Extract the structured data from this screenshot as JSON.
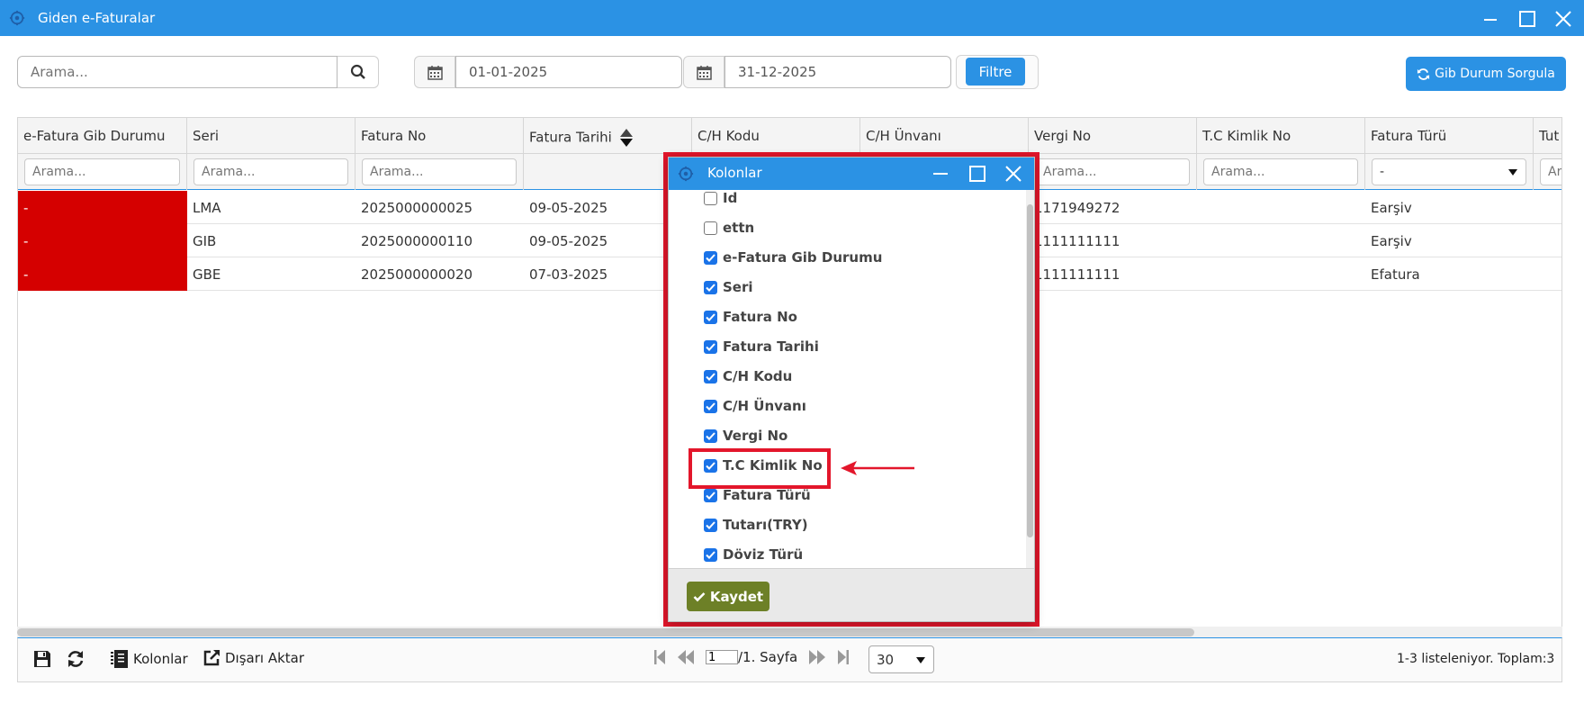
{
  "window": {
    "title": "Giden e-Faturalar",
    "icons": [
      "gear-icon",
      "minimize-icon",
      "maximize-icon",
      "close-icon"
    ]
  },
  "toolbar": {
    "search_placeholder": "Arama...",
    "date_start": "01-01-2025",
    "date_end": "31-12-2025",
    "filter_label": "Filtre",
    "gib_button_label": "Gib Durum Sorgula"
  },
  "grid": {
    "columns": [
      "e-Fatura Gib Durumu",
      "Seri",
      "Fatura No",
      "Fatura Tarihi",
      "C/H Kodu",
      "C/H Ünvanı",
      "Vergi No",
      "T.C Kimlik No",
      "Fatura Türü",
      "Tut"
    ],
    "filter_placeholder": "Arama...",
    "filter_placeholder_clipped": "Ar",
    "fatura_turu_filter_value": "-",
    "rows": [
      {
        "status": "-",
        "seri": "LMA",
        "fatura_no": "2025000000025",
        "tarih": "09-05-2025",
        "vergi_no": "1171949272",
        "tur": "Earşiv"
      },
      {
        "status": "-",
        "seri": "GIB",
        "fatura_no": "2025000000110",
        "tarih": "09-05-2025",
        "vergi_no": "1111111111",
        "tur": "Earşiv"
      },
      {
        "status": "-",
        "seri": "GBE",
        "fatura_no": "2025000000020",
        "tarih": "07-03-2025",
        "vergi_no": "1111111111",
        "tur": "Efatura"
      }
    ],
    "status_color": "#d50000"
  },
  "footer": {
    "kolonlar_label": "Kolonlar",
    "export_label": "Dışarı Aktar",
    "page_value": "1",
    "page_suffix": "/1. Sayfa",
    "page_size": "30",
    "summary": "1-3 listeleniyor. Toplam:3"
  },
  "dialog": {
    "title": "Kolonlar",
    "items": [
      {
        "label": "Id",
        "checked": false
      },
      {
        "label": "ettn",
        "checked": false
      },
      {
        "label": "e-Fatura Gib Durumu",
        "checked": true
      },
      {
        "label": "Seri",
        "checked": true
      },
      {
        "label": "Fatura No",
        "checked": true
      },
      {
        "label": "Fatura Tarihi",
        "checked": true
      },
      {
        "label": "C/H Kodu",
        "checked": true
      },
      {
        "label": "C/H Ünvanı",
        "checked": true
      },
      {
        "label": "Vergi No",
        "checked": true
      },
      {
        "label": "T.C Kimlik No",
        "checked": true
      },
      {
        "label": "Fatura Türü",
        "checked": true
      },
      {
        "label": "Tutarı(TRY)",
        "checked": true
      },
      {
        "label": "Döviz Türü",
        "checked": true
      }
    ],
    "save_label": "Kaydet"
  },
  "colors": {
    "accent": "#2b92e4",
    "highlight": "#e3162b",
    "save": "#6d8027"
  }
}
